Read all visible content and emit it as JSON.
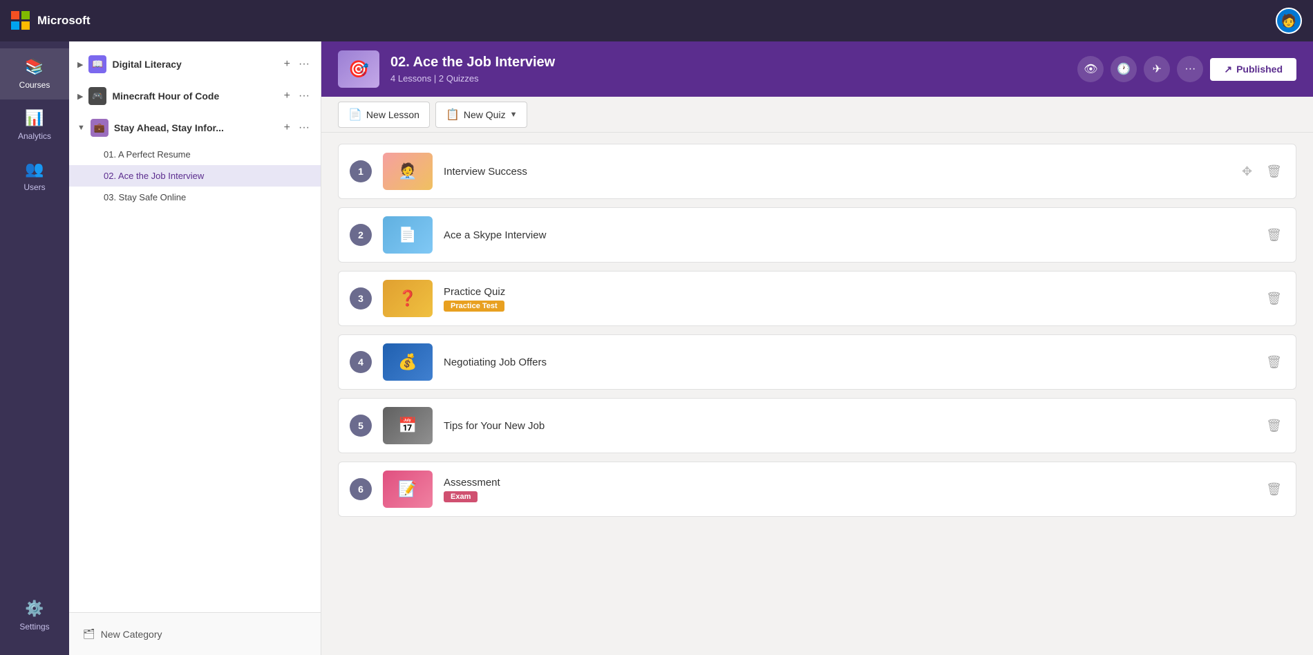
{
  "app": {
    "brand": "Microsoft"
  },
  "topbar": {
    "brand_label": "Microsoft",
    "avatar_initial": "👤"
  },
  "nav": {
    "items": [
      {
        "id": "courses",
        "label": "Courses",
        "icon": "📚",
        "active": true
      },
      {
        "id": "analytics",
        "label": "Analytics",
        "icon": "📊",
        "active": false
      },
      {
        "id": "users",
        "label": "Users",
        "icon": "👥",
        "active": false
      },
      {
        "id": "settings",
        "label": "Settings",
        "icon": "⚙️",
        "active": false
      }
    ]
  },
  "sidebar": {
    "courses": [
      {
        "id": "digital-literacy",
        "name": "Digital Literacy",
        "expanded": false,
        "lessons": []
      },
      {
        "id": "minecraft",
        "name": "Minecraft Hour of Code",
        "expanded": false,
        "lessons": []
      },
      {
        "id": "stay-ahead",
        "name": "Stay Ahead, Stay Infor...",
        "expanded": true,
        "lessons": [
          {
            "id": "01",
            "name": "01. A Perfect Resume",
            "active": false
          },
          {
            "id": "02",
            "name": "02. Ace the Job Interview",
            "active": true
          },
          {
            "id": "03",
            "name": "03. Stay Safe Online",
            "active": false
          }
        ]
      }
    ],
    "new_category_label": "New Category"
  },
  "course_header": {
    "title": "02. Ace the Job Interview",
    "meta": "4 Lessons | 2 Quizzes",
    "published_label": "Published",
    "icon_eye": "👁",
    "icon_clock": "🕐",
    "icon_share": "✈"
  },
  "toolbar": {
    "new_lesson_label": "New Lesson",
    "new_quiz_label": "New Quiz"
  },
  "content_items": [
    {
      "number": "1",
      "title": "Interview Success",
      "type": "lesson",
      "badge": null,
      "thumb_class": "item-thumb-1"
    },
    {
      "number": "2",
      "title": "Ace a Skype Interview",
      "type": "lesson",
      "badge": null,
      "thumb_class": "item-thumb-2"
    },
    {
      "number": "3",
      "title": "Practice Quiz",
      "type": "quiz",
      "badge": "Practice Test",
      "badge_class": "badge-practice",
      "thumb_class": "item-thumb-3"
    },
    {
      "number": "4",
      "title": "Negotiating Job Offers",
      "type": "lesson",
      "badge": null,
      "thumb_class": "item-thumb-4"
    },
    {
      "number": "5",
      "title": "Tips for Your New Job",
      "type": "lesson",
      "badge": null,
      "thumb_class": "item-thumb-5"
    },
    {
      "number": "6",
      "title": "Assessment",
      "type": "quiz",
      "badge": "Exam",
      "badge_class": "badge-exam",
      "thumb_class": "item-thumb-6"
    }
  ]
}
